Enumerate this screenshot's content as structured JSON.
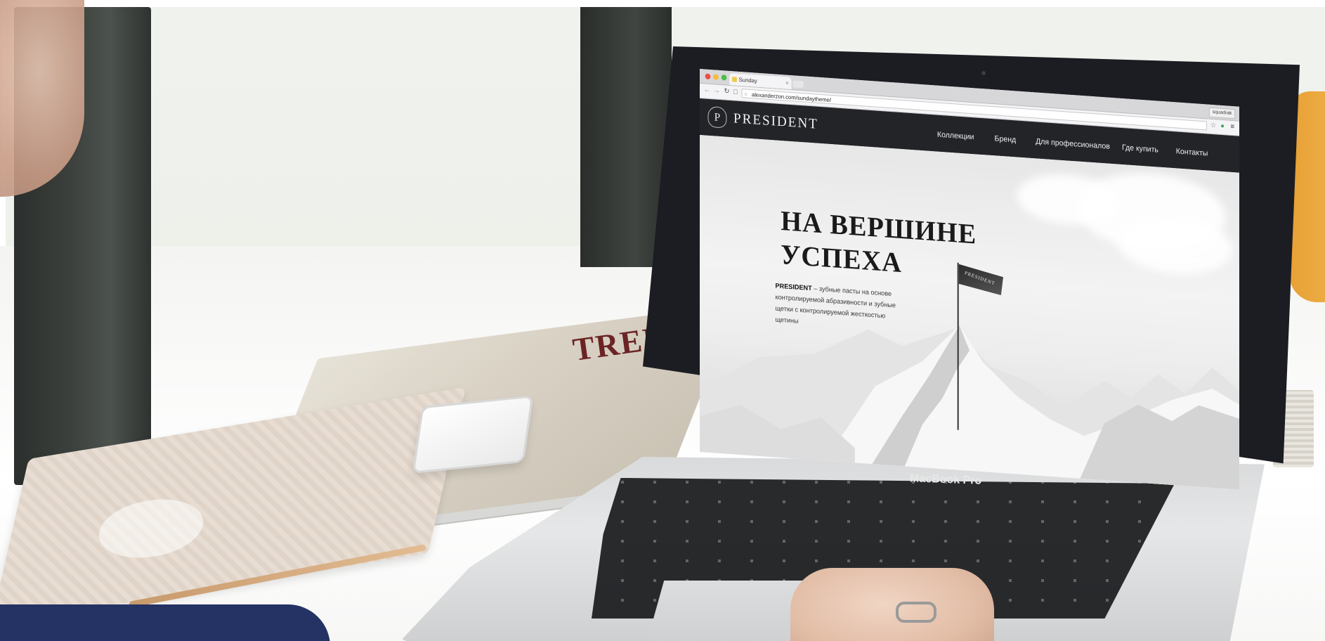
{
  "magazine": {
    "cover_text": "TREE"
  },
  "laptop": {
    "model_label": "MacBook Pro"
  },
  "browser": {
    "tab_title": "Sunday",
    "tab_close": "×",
    "url": "alexanderzon.com/sundaytheme/",
    "profile": "squadrak",
    "icons": {
      "back": "arrow-left-icon",
      "forward": "arrow-right-icon",
      "reload": "reload-icon",
      "star": "star-icon",
      "extension": "extension-icon",
      "menu": "menu-icon"
    }
  },
  "site": {
    "logo_mark": "P",
    "logo_text": "PRESIDENT",
    "nav": [
      {
        "label": "Коллекции"
      },
      {
        "label": "Бренд"
      },
      {
        "label": "Для профессионалов"
      },
      {
        "label": "Где купить"
      },
      {
        "label": "Контакты"
      }
    ],
    "hero": {
      "title_line1": "НА ВЕРШИНЕ",
      "title_line2": "УСПЕХА",
      "desc_brand": "PRESIDENT",
      "desc_rest": " – зубные пасты на основе контролируемой абразивности и зубные щетки с контролируемой жесткостью щетины",
      "flag_text": "PRESIDENT"
    }
  },
  "colors": {
    "site_header": "#232428",
    "hero_text": "#1a1a1a",
    "laptop_bezel": "#1b1d22",
    "orange_chair": "#f0b24b",
    "sweater": "#243264"
  }
}
